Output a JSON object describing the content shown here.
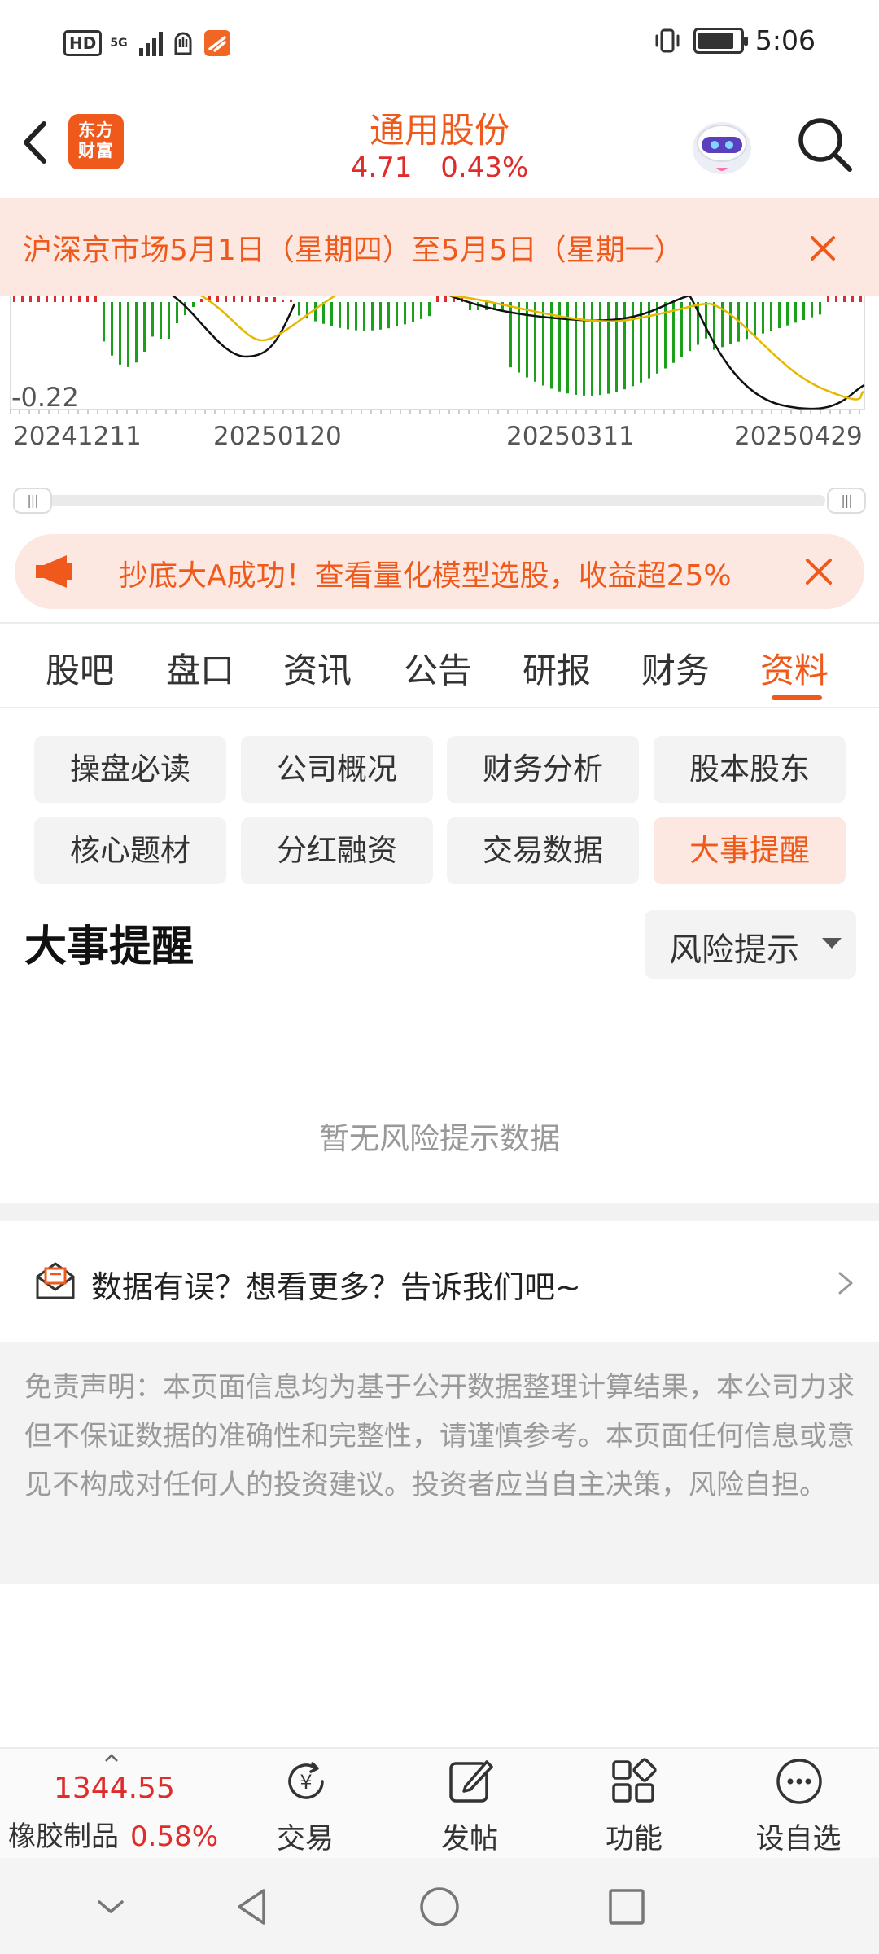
{
  "status_bar": {
    "hd_label": "HD",
    "network_label": "5G",
    "time": "5:06",
    "battery_level": 0.85
  },
  "header": {
    "logo_line1": "东方",
    "logo_line2": "财富",
    "stock_name": "通用股份",
    "price": "4.71",
    "change_pct": "0.43%"
  },
  "notice": {
    "text": "沪深京市场5月1日（星期四）至5月5日（星期一）"
  },
  "chart": {
    "y_label": "-0.22",
    "x_labels": [
      "20241211",
      "20250120",
      "20250311",
      "20250429"
    ]
  },
  "ad": {
    "text": "抄底大A成功！查看量化模型选股，收益超25%"
  },
  "tabs": [
    "股吧",
    "盘口",
    "资讯",
    "公告",
    "研报",
    "财务",
    "资料"
  ],
  "active_tab": "资料",
  "chips": [
    "操盘必读",
    "公司概况",
    "财务分析",
    "股本股东",
    "核心题材",
    "分红融资",
    "交易数据",
    "大事提醒"
  ],
  "active_chip": "大事提醒",
  "section": {
    "title": "大事提醒",
    "dropdown_value": "风险提示",
    "empty_text": "暂无风险提示数据"
  },
  "feedback": {
    "text": "数据有误？想看更多？告诉我们吧~"
  },
  "disclaimer": {
    "text": "免责声明：本页面信息均为基于公开数据整理计算结果，本公司力求但不保证数据的准确性和完整性，请谨慎参考。本页面任何信息或意见不构成对任何人的投资建议。投资者应当自主决策，风险自担。"
  },
  "bottom_bar": {
    "index_value": "1344.55",
    "index_name": "橡胶制品",
    "index_change": "0.58%",
    "items": [
      {
        "label": "交易",
        "icon": "trade-icon"
      },
      {
        "label": "发帖",
        "icon": "post-icon"
      },
      {
        "label": "功能",
        "icon": "functions-icon"
      },
      {
        "label": "设自选",
        "icon": "more-icon"
      }
    ]
  },
  "colors": {
    "accent": "#ef5a1c",
    "up": "#e02b2b",
    "down": "#1aa01a",
    "ma_black": "#111111",
    "ma_yellow": "#e6b800"
  }
}
